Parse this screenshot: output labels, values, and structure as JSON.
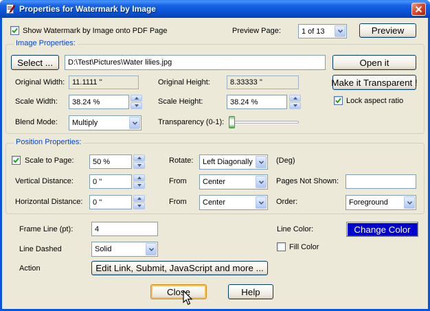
{
  "window": {
    "title": "Properties for Watermark by Image"
  },
  "icons": {
    "app": "document-pen",
    "close": "x-cross",
    "combo": "chevron-down",
    "spin_up": "triangle-up",
    "spin_down": "triangle-down",
    "checkbox": "green-check",
    "cursor": "arrow-pointer"
  },
  "header": {
    "show_watermark": {
      "label": "Show Watermark by Image onto PDF Page",
      "checked": true
    },
    "preview_page_label": "Preview Page:",
    "preview_page_value": "1 of 13",
    "preview_button": "Preview"
  },
  "image_properties": {
    "title": "Image Properties:",
    "select_button": "Select ...",
    "image_path": "D:\\Test\\Pictures\\Water lilies.jpg",
    "open_button": "Open it",
    "original_width_label": "Original Width:",
    "original_width_value": "11.1111 ''",
    "original_height_label": "Original Height:",
    "original_height_value": "8.33333 ''",
    "make_transparent_button": "Make it Transparent !",
    "scale_width_label": "Scale Width:",
    "scale_width_value": "38.24 %",
    "scale_height_label": "Scale Height:",
    "scale_height_value": "38.24 %",
    "lock_aspect_ratio": {
      "label": "Lock aspect ratio",
      "checked": true
    },
    "blend_mode_label": "Blend Mode:",
    "blend_mode_value": "Multiply",
    "transparency_label": "Transparency (0-1):",
    "transparency_value": 0,
    "transparency_range": [
      0,
      1
    ]
  },
  "position_properties": {
    "title": "Position Properties:",
    "scale_to_page": {
      "label": "Scale to Page:",
      "checked": true,
      "value": "50 %"
    },
    "rotate_label": "Rotate:",
    "rotate_value": "Left Diagonally",
    "deg_label": "(Deg)",
    "vertical_distance_label": "Vertical Distance:",
    "vertical_distance_value": "0 ''",
    "vertical_from_label": "From",
    "vertical_from_value": "Center",
    "pages_not_shown_label": "Pages Not Shown:",
    "pages_not_shown_value": "",
    "horizontal_distance_label": "Horizontal Distance:",
    "horizontal_distance_value": "0 ''",
    "horizontal_from_label": "From",
    "horizontal_from_value": "Center",
    "order_label": "Order:",
    "order_value": "Foreground"
  },
  "frame": {
    "frame_line_label": "Frame Line (pt):",
    "frame_line_value": "4",
    "line_color_label": "Line Color:",
    "change_color_button": "Change Color",
    "line_dashed_label": "Line Dashed",
    "line_dashed_value": "Solid",
    "fill_color": {
      "label": "Fill Color",
      "checked": false
    },
    "action_label": "Action",
    "action_button": "Edit Link, Submit, JavaScript and more ..."
  },
  "footer": {
    "close_button": "Close",
    "help_button": "Help"
  },
  "colors": {
    "titlebar": "#0A5BDB",
    "window_border": "#0855DD",
    "dialog_bg": "#ECE9D8",
    "group_label": "#0046D5",
    "field_border": "#7F9DB9",
    "change_color_face": "#0202CE",
    "close_focus_ring": "#F9BE5F"
  }
}
